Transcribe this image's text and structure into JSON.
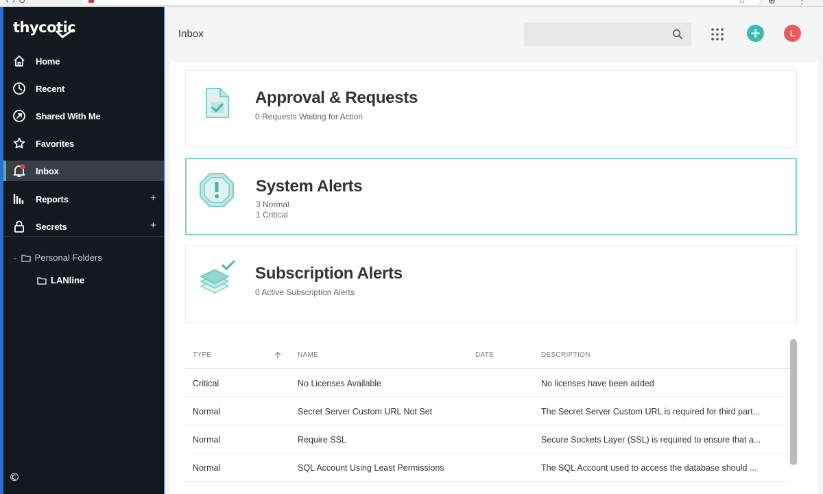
{
  "app": {
    "logo_text": "thycotic"
  },
  "sidebar": {
    "nav": [
      {
        "id": "home",
        "label": "Home",
        "icon": "home-icon"
      },
      {
        "id": "recent",
        "label": "Recent",
        "icon": "clock-icon"
      },
      {
        "id": "shared",
        "label": "Shared With Me",
        "icon": "share-icon"
      },
      {
        "id": "favorites",
        "label": "Favorites",
        "icon": "star-icon"
      },
      {
        "id": "inbox",
        "label": "Inbox",
        "icon": "bell-icon",
        "active": true
      },
      {
        "id": "reports",
        "label": "Reports",
        "icon": "bar-chart-icon",
        "expandable": true
      },
      {
        "id": "secrets",
        "label": "Secrets",
        "icon": "lock-icon",
        "expandable": true
      }
    ],
    "expand_symbol": "+",
    "tree": {
      "root": "Personal Folders",
      "children": [
        "LANline"
      ]
    },
    "copyright": "©"
  },
  "header": {
    "title": "Inbox",
    "search_placeholder": "",
    "avatar_initial": "L"
  },
  "cards": [
    {
      "title": "Approval & Requests",
      "lines": [
        "0 Requests Waiting for Action"
      ],
      "icon": "document-check-icon"
    },
    {
      "title": "System Alerts",
      "lines": [
        "3 Normal",
        "1 Critical"
      ],
      "icon": "alert-octagon-icon",
      "selected": true
    },
    {
      "title": "Subscription Alerts",
      "lines": [
        "0 Active Subscription Alerts"
      ],
      "icon": "layers-check-icon"
    }
  ],
  "table": {
    "columns": [
      "TYPE",
      "NAME",
      "DATE",
      "DESCRIPTION"
    ],
    "sort_column": "TYPE",
    "sort_direction": "ascending",
    "rows": [
      {
        "type": "Critical",
        "name": "No Licenses Available",
        "date": "",
        "description": "No licenses have been added"
      },
      {
        "type": "Normal",
        "name": "Secret Server Custom URL Not Set",
        "date": "",
        "description": "The Secret Server Custom URL is required for third part..."
      },
      {
        "type": "Normal",
        "name": "Require SSL",
        "date": "",
        "description": "Secure Sockets Layer (SSL) is required to ensure that a..."
      },
      {
        "type": "Normal",
        "name": "SQL Account Using Least Permissions",
        "date": "",
        "description": "The SQL Account used to access the database should ..."
      }
    ]
  },
  "colors": {
    "sidebar_bg": "#14181f",
    "accent_teal": "#3fb8ad",
    "avatar_red": "#ea5b5f",
    "notification_dot": "#e0413f"
  }
}
